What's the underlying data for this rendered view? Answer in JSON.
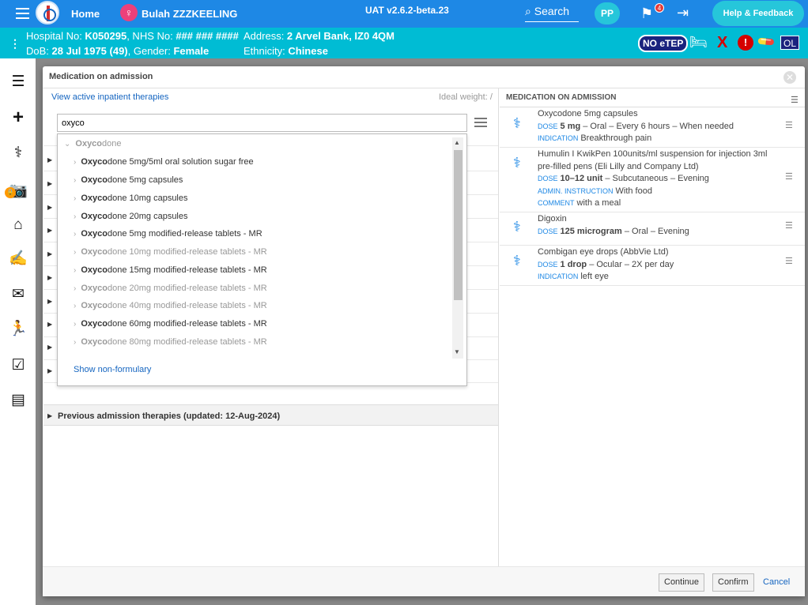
{
  "topbar": {
    "home": "Home",
    "patient_name": "Bulah ZZZKEELING",
    "version": "UAT v2.6.2-beta.23",
    "search": "Search",
    "avatar": "PP",
    "flag_count": "4",
    "help": "Help & Feedback"
  },
  "patient": {
    "hospital_label": "Hospital No: ",
    "hospital_no": "K050295",
    "nhs_label": ", NHS No: ",
    "nhs_no": "### ### ####",
    "dob_label": "DoB: ",
    "dob": "28 Jul 1975 (49)",
    "gender_label": ", Gender: ",
    "gender": "Female",
    "address_label": "Address: ",
    "address": "2 Arvel Bank, IZ0 4QM",
    "ethnicity_label": "Ethnicity: ",
    "ethnicity": "Chinese",
    "no_etep": "NO eTEP",
    "ol": "OL"
  },
  "modal": {
    "title": "Medication on admission",
    "view_active": "View active inpatient therapies",
    "ideal_weight": "Ideal weight: /",
    "search_value": "oxyco",
    "show_non_formulary": "Show non-formulary",
    "previous": "Previous admission therapies (updated: 12-Aug-2024)",
    "dropdown": {
      "group_bold": "Oxyco",
      "group_rest": "done",
      "items": [
        {
          "bold": "Oxyco",
          "rest": "done 5mg/5ml oral solution sugar free"
        },
        {
          "bold": "Oxyco",
          "rest": "done 5mg capsules"
        },
        {
          "bold": "Oxyco",
          "rest": "done 10mg capsules"
        },
        {
          "bold": "Oxyco",
          "rest": "done 20mg capsules"
        },
        {
          "bold": "Oxyco",
          "rest": "done 5mg modified-release tablets - MR"
        },
        {
          "bold": "Oxyco",
          "rest": "done 10mg modified-release tablets - MR"
        },
        {
          "bold": "Oxyco",
          "rest": "done 15mg modified-release tablets - MR"
        },
        {
          "bold": "Oxyco",
          "rest": "done 20mg modified-release tablets - MR"
        },
        {
          "bold": "Oxyco",
          "rest": "done 40mg modified-release tablets - MR"
        },
        {
          "bold": "Oxyco",
          "rest": "done 60mg modified-release tablets - MR"
        },
        {
          "bold": "Oxyco",
          "rest": "done 80mg modified-release tablets - MR"
        }
      ]
    },
    "right_header": "MEDICATION ON ADMISSION",
    "meds": [
      {
        "name": "Oxycodone 5mg capsules",
        "dose_label": "DOSE",
        "dose": "5 mg",
        "route": " – Oral – Every 6 hours – When needed",
        "extra_label": "INDICATION",
        "extra": "Breakthrough pain"
      },
      {
        "name1": "Humulin I KwikPen 100units/ml suspension for injection 3ml",
        "name2": "pre-filled pens (Eli Lilly and Company Ltd)",
        "dose_label": "DOSE",
        "dose": "10–12 unit",
        "route": " – Subcutaneous – Evening",
        "admin_label": "ADMIN. INSTRUCTION",
        "admin": "With food",
        "comment_label": "COMMENT",
        "comment": "with a meal"
      },
      {
        "name": "Digoxin",
        "dose_label": "DOSE",
        "dose": "125 microgram",
        "route": " – Oral – Evening"
      },
      {
        "name": "Combigan eye drops (AbbVie Ltd)",
        "dose_label": "DOSE",
        "dose": "1 drop",
        "route": " – Ocular – 2X per day",
        "extra_label": "INDICATION",
        "extra": "left eye"
      }
    ],
    "buttons": {
      "continue": "Continue",
      "confirm": "Confirm",
      "cancel": "Cancel"
    }
  },
  "colors": {
    "topbar": "#1e88e5",
    "patientbar": "#00bcd4",
    "link": "#1565c0"
  }
}
